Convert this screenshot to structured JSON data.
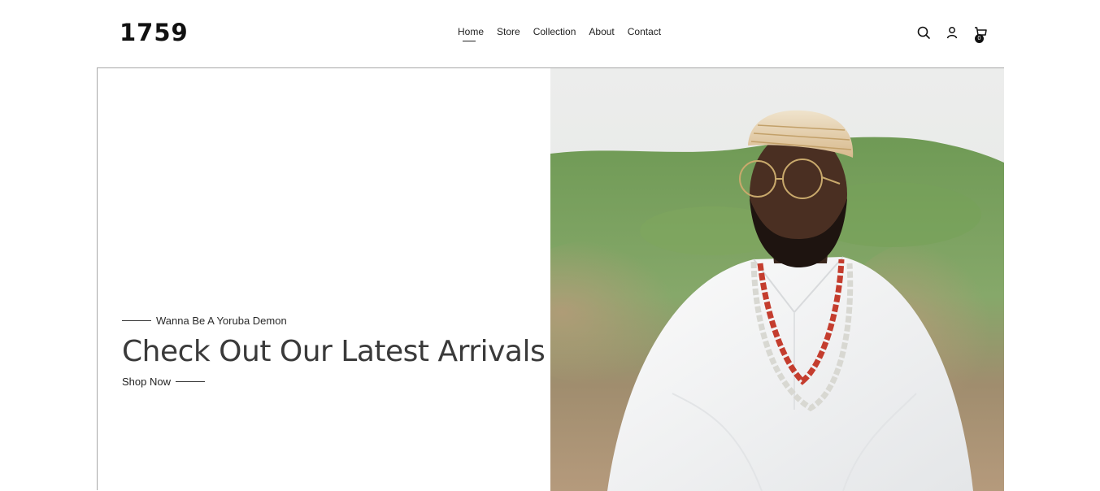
{
  "header": {
    "logo": "1759",
    "nav": [
      {
        "label": "Home",
        "active": true
      },
      {
        "label": "Store",
        "active": false
      },
      {
        "label": "Collection",
        "active": false
      },
      {
        "label": "About",
        "active": false
      },
      {
        "label": "Contact",
        "active": false
      }
    ],
    "icons": [
      "search-icon",
      "user-icon",
      "cart-icon"
    ],
    "cart_count": "0"
  },
  "hero": {
    "eyebrow": "Wanna Be A Yoruba Demon",
    "headline": "Check Out Our Latest Arrivals",
    "cta": "Shop Now",
    "image_subject": "man in white agbada with red coral beads and gold cap"
  },
  "colors": {
    "text": "#1a1a1a",
    "headline": "#3a3a3a",
    "border": "#a8a8a8",
    "background": "#ffffff"
  }
}
